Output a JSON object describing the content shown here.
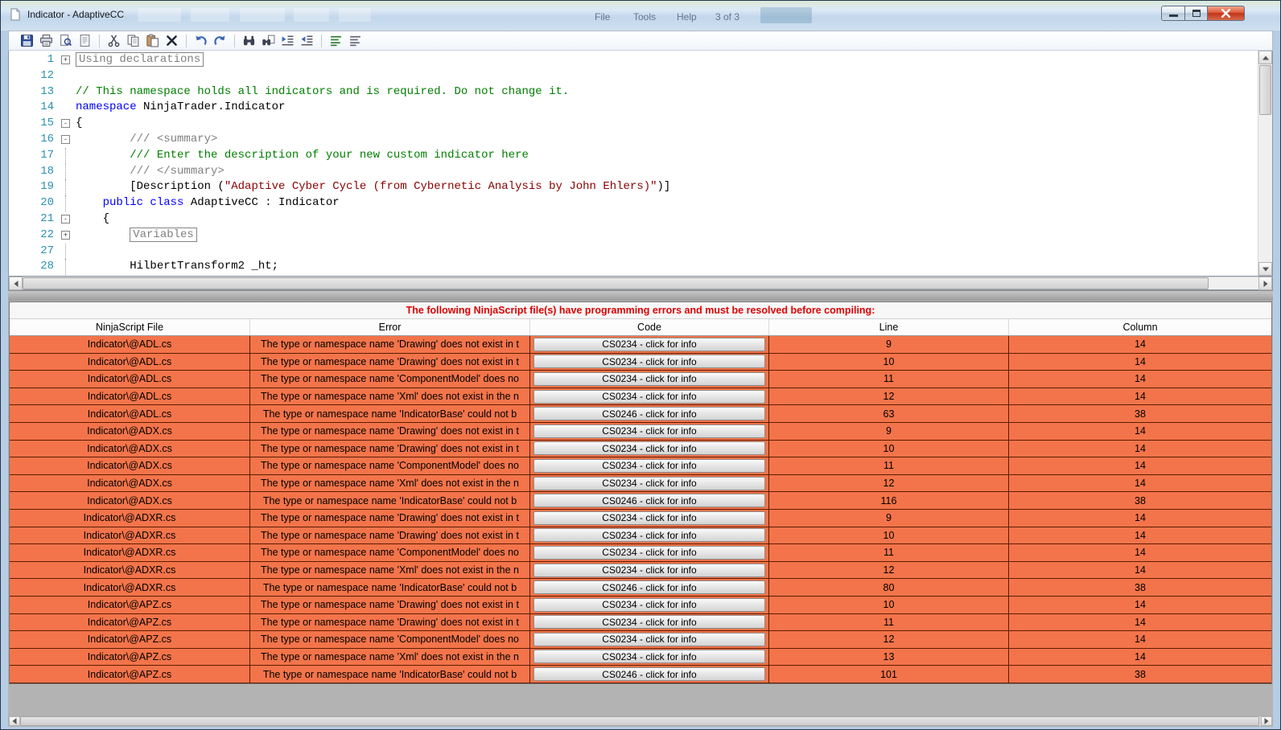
{
  "window": {
    "title": "Indicator - AdaptiveCC",
    "controls": [
      "minimize",
      "maximize",
      "close"
    ]
  },
  "background_window": {
    "menu_items": [
      "File",
      "Tools",
      "Help"
    ],
    "page_indicator": "3 of 3"
  },
  "toolbar": {
    "items": [
      "save-icon",
      "print-icon",
      "print-preview-icon",
      "page-setup-icon",
      "|",
      "cut-icon",
      "copy-icon",
      "paste-icon",
      "delete-icon",
      "|",
      "undo-icon",
      "redo-icon",
      "|",
      "find-icon",
      "find-in-files-icon",
      "indent-icon",
      "outdent-icon",
      "|",
      "comment-icon",
      "uncomment-icon"
    ]
  },
  "editor": {
    "lines": [
      {
        "num": "1",
        "fold": "+",
        "segments": [
          {
            "text": "Using declarations",
            "style": "region"
          }
        ]
      },
      {
        "num": "12",
        "segments": []
      },
      {
        "num": "13",
        "segments": [
          {
            "text": "// This namespace holds all indicators and is required. Do not change it.",
            "style": "comment"
          }
        ]
      },
      {
        "num": "14",
        "segments": [
          {
            "text": "namespace",
            "style": "keyword"
          },
          {
            "text": " NinjaTrader.Indicator",
            "style": "plain"
          }
        ]
      },
      {
        "num": "15",
        "fold": "-",
        "segments": [
          {
            "text": "{",
            "style": "plain"
          }
        ]
      },
      {
        "num": "16",
        "fold": "-",
        "segments": [
          {
            "text": "        ",
            "style": "plain"
          },
          {
            "text": "/// <summary>",
            "style": "doc"
          }
        ]
      },
      {
        "num": "17",
        "guide": true,
        "segments": [
          {
            "text": "        ",
            "style": "plain"
          },
          {
            "text": "/// Enter the description of your new custom indicator here",
            "style": "comment"
          }
        ]
      },
      {
        "num": "18",
        "guide": true,
        "segments": [
          {
            "text": "        ",
            "style": "plain"
          },
          {
            "text": "/// </summary>",
            "style": "doc"
          }
        ]
      },
      {
        "num": "19",
        "guide": true,
        "segments": [
          {
            "text": "        [Description (",
            "style": "plain"
          },
          {
            "text": "\"Adaptive Cyber Cycle (from Cybernetic Analysis by John Ehlers)\"",
            "style": "string"
          },
          {
            "text": ")]",
            "style": "plain"
          }
        ]
      },
      {
        "num": "20",
        "guide": true,
        "segments": [
          {
            "text": "    ",
            "style": "plain"
          },
          {
            "text": "public class",
            "style": "keyword"
          },
          {
            "text": " AdaptiveCC : Indicator",
            "style": "plain"
          }
        ]
      },
      {
        "num": "21",
        "fold": "-",
        "segments": [
          {
            "text": "    {",
            "style": "plain"
          }
        ]
      },
      {
        "num": "22",
        "fold": "+",
        "segments": [
          {
            "text": "        ",
            "style": "plain"
          },
          {
            "text": "Variables",
            "style": "region"
          }
        ]
      },
      {
        "num": "27",
        "guide": true,
        "segments": []
      },
      {
        "num": "28",
        "guide": true,
        "segments": [
          {
            "text": "        HilbertTransform2 _ht;",
            "style": "plain"
          }
        ]
      }
    ]
  },
  "error_panel": {
    "message": "The following NinjaScript file(s) have programming errors and must be resolved before compiling:",
    "columns": [
      "NinjaScript File",
      "Error",
      "Code",
      "Line",
      "Column"
    ],
    "rows": [
      {
        "file": "Indicator\\@ADL.cs",
        "error": "The type or namespace name 'Drawing' does not exist in t",
        "code": "CS0234 - click for info",
        "line": "9",
        "column": "14"
      },
      {
        "file": "Indicator\\@ADL.cs",
        "error": "The type or namespace name 'Drawing' does not exist in t",
        "code": "CS0234 - click for info",
        "line": "10",
        "column": "14"
      },
      {
        "file": "Indicator\\@ADL.cs",
        "error": "The type or namespace name 'ComponentModel' does no",
        "code": "CS0234 - click for info",
        "line": "11",
        "column": "14"
      },
      {
        "file": "Indicator\\@ADL.cs",
        "error": "The type or namespace name 'Xml' does not exist in the n",
        "code": "CS0234 - click for info",
        "line": "12",
        "column": "14"
      },
      {
        "file": "Indicator\\@ADL.cs",
        "error": "The type or namespace name 'IndicatorBase' could not b",
        "code": "CS0246 - click for info",
        "line": "63",
        "column": "38"
      },
      {
        "file": "Indicator\\@ADX.cs",
        "error": "The type or namespace name 'Drawing' does not exist in t",
        "code": "CS0234 - click for info",
        "line": "9",
        "column": "14"
      },
      {
        "file": "Indicator\\@ADX.cs",
        "error": "The type or namespace name 'Drawing' does not exist in t",
        "code": "CS0234 - click for info",
        "line": "10",
        "column": "14"
      },
      {
        "file": "Indicator\\@ADX.cs",
        "error": "The type or namespace name 'ComponentModel' does no",
        "code": "CS0234 - click for info",
        "line": "11",
        "column": "14"
      },
      {
        "file": "Indicator\\@ADX.cs",
        "error": "The type or namespace name 'Xml' does not exist in the n",
        "code": "CS0234 - click for info",
        "line": "12",
        "column": "14"
      },
      {
        "file": "Indicator\\@ADX.cs",
        "error": "The type or namespace name 'IndicatorBase' could not b",
        "code": "CS0246 - click for info",
        "line": "116",
        "column": "38"
      },
      {
        "file": "Indicator\\@ADXR.cs",
        "error": "The type or namespace name 'Drawing' does not exist in t",
        "code": "CS0234 - click for info",
        "line": "9",
        "column": "14"
      },
      {
        "file": "Indicator\\@ADXR.cs",
        "error": "The type or namespace name 'Drawing' does not exist in t",
        "code": "CS0234 - click for info",
        "line": "10",
        "column": "14"
      },
      {
        "file": "Indicator\\@ADXR.cs",
        "error": "The type or namespace name 'ComponentModel' does no",
        "code": "CS0234 - click for info",
        "line": "11",
        "column": "14"
      },
      {
        "file": "Indicator\\@ADXR.cs",
        "error": "The type or namespace name 'Xml' does not exist in the n",
        "code": "CS0234 - click for info",
        "line": "12",
        "column": "14"
      },
      {
        "file": "Indicator\\@ADXR.cs",
        "error": "The type or namespace name 'IndicatorBase' could not b",
        "code": "CS0246 - click for info",
        "line": "80",
        "column": "38"
      },
      {
        "file": "Indicator\\@APZ.cs",
        "error": "The type or namespace name 'Drawing' does not exist in t",
        "code": "CS0234 - click for info",
        "line": "10",
        "column": "14"
      },
      {
        "file": "Indicator\\@APZ.cs",
        "error": "The type or namespace name 'Drawing' does not exist in t",
        "code": "CS0234 - click for info",
        "line": "11",
        "column": "14"
      },
      {
        "file": "Indicator\\@APZ.cs",
        "error": "The type or namespace name 'ComponentModel' does no",
        "code": "CS0234 - click for info",
        "line": "12",
        "column": "14"
      },
      {
        "file": "Indicator\\@APZ.cs",
        "error": "The type or namespace name 'Xml' does not exist in the n",
        "code": "CS0234 - click for info",
        "line": "13",
        "column": "14"
      },
      {
        "file": "Indicator\\@APZ.cs",
        "error": "The type or namespace name 'IndicatorBase' could not b",
        "code": "CS0246 - click for info",
        "line": "101",
        "column": "38"
      }
    ]
  },
  "colors": {
    "error_row_orange": "#f3744a",
    "error_message_red": "#e00000",
    "keyword_blue": "#0000ff",
    "comment_green": "#007f00",
    "doc_comment_gray": "#7f7f7f",
    "string_maroon": "#8b0000",
    "line_number_teal": "#2b91af",
    "titlebar_blue": "#cfe0f0"
  }
}
